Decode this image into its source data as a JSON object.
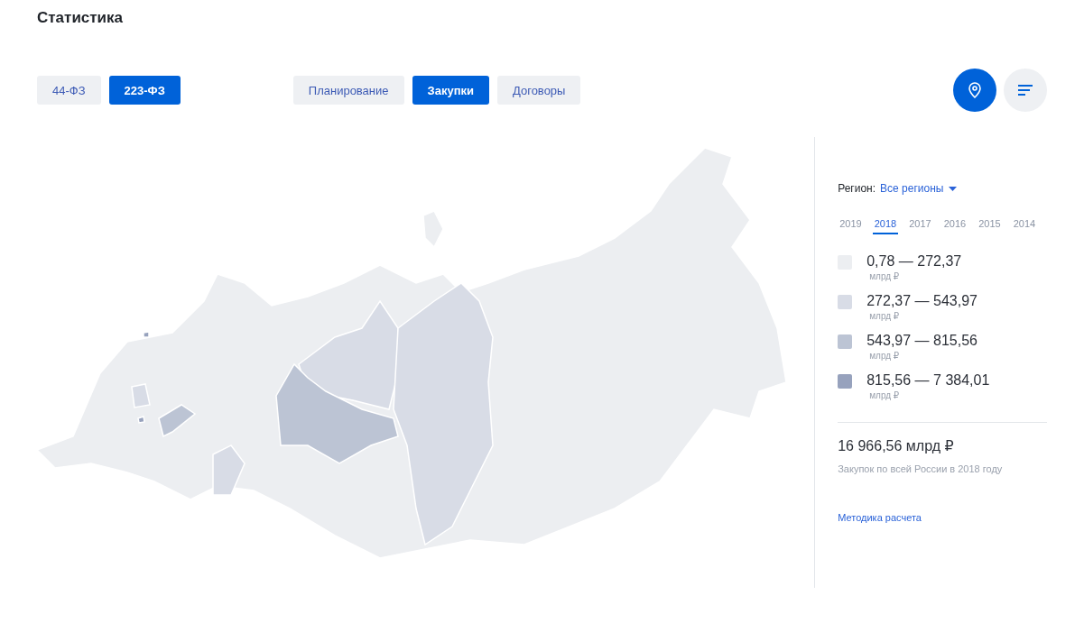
{
  "title": "Статистика",
  "law_tabs": [
    {
      "label": "44-ФЗ",
      "selected": false
    },
    {
      "label": "223-ФЗ",
      "selected": true
    }
  ],
  "stage_tabs": [
    {
      "label": "Планирование",
      "selected": false
    },
    {
      "label": "Закупки",
      "selected": true
    },
    {
      "label": "Договоры",
      "selected": false
    }
  ],
  "view_toggles": [
    {
      "kind": "map",
      "selected": true
    },
    {
      "kind": "list",
      "selected": false
    }
  ],
  "region": {
    "label": "Регион:",
    "value": "Все регионы"
  },
  "years": [
    {
      "label": "2019",
      "selected": false
    },
    {
      "label": "2018",
      "selected": true
    },
    {
      "label": "2017",
      "selected": false
    },
    {
      "label": "2016",
      "selected": false
    },
    {
      "label": "2015",
      "selected": false
    },
    {
      "label": "2014",
      "selected": false
    }
  ],
  "legend": [
    {
      "range": "0,78 — 272,37",
      "unit": "млрд ₽",
      "color": "#eceef1"
    },
    {
      "range": "272,37 — 543,97",
      "unit": "млрд ₽",
      "color": "#d8dce6"
    },
    {
      "range": "543,97 — 815,56",
      "unit": "млрд ₽",
      "color": "#bcc4d4"
    },
    {
      "range": "815,56 — 7 384,01",
      "unit": "млрд ₽",
      "color": "#97a2bd"
    }
  ],
  "total": {
    "value": "16 966,56 млрд ₽",
    "caption": "Закупок по всей России в 2018 году"
  },
  "method_link": "Методика расчета"
}
